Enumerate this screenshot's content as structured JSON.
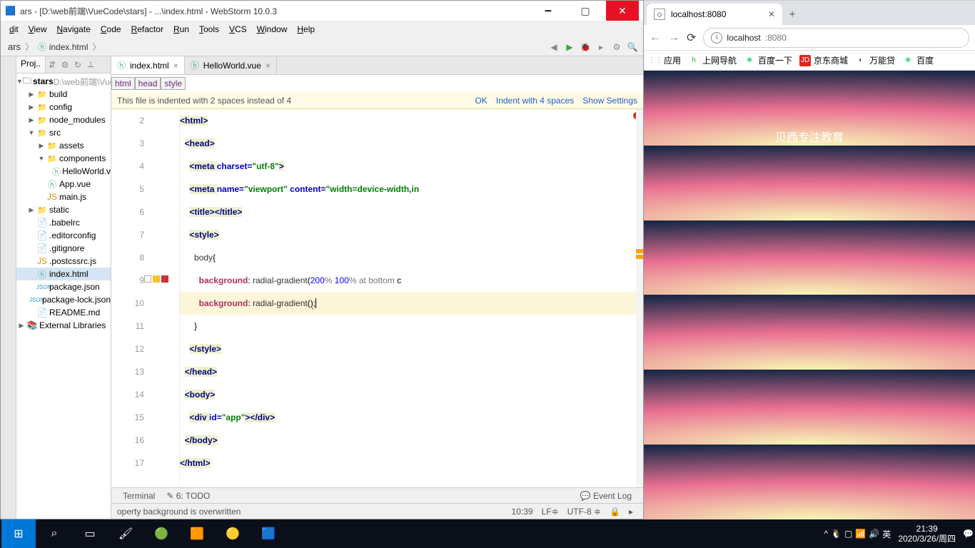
{
  "ide": {
    "title": "ars - [D:\\web前端\\VueCode\\stars] - ...\\index.html - WebStorm 10.0.3",
    "menu": [
      "dit",
      "View",
      "Navigate",
      "Code",
      "Refactor",
      "Run",
      "Tools",
      "VCS",
      "Window",
      "Help"
    ],
    "breadcrumb": {
      "root": "ars",
      "file": "index.html"
    },
    "project_tab": "Proj..",
    "project": {
      "root": {
        "name": "stars",
        "path": "D:\\web前端\\Vue"
      },
      "items": [
        {
          "t": "dir",
          "name": "build",
          "d": 1
        },
        {
          "t": "dir",
          "name": "config",
          "d": 1
        },
        {
          "t": "dir",
          "name": "node_modules",
          "d": 1
        },
        {
          "t": "dir",
          "name": "src",
          "d": 1,
          "open": true
        },
        {
          "t": "dir",
          "name": "assets",
          "d": 2
        },
        {
          "t": "dir",
          "name": "components",
          "d": 2,
          "open": true
        },
        {
          "t": "file",
          "name": "HelloWorld.v",
          "d": 3,
          "icon": "h"
        },
        {
          "t": "file",
          "name": "App.vue",
          "d": 2,
          "icon": "h"
        },
        {
          "t": "file",
          "name": "main.js",
          "d": 2,
          "icon": "js"
        },
        {
          "t": "dir",
          "name": "static",
          "d": 1
        },
        {
          "t": "file",
          "name": ".babelrc",
          "d": 1,
          "icon": "txt"
        },
        {
          "t": "file",
          "name": ".editorconfig",
          "d": 1,
          "icon": "txt"
        },
        {
          "t": "file",
          "name": ".gitignore",
          "d": 1,
          "icon": "txt"
        },
        {
          "t": "file",
          "name": ".postcssrc.js",
          "d": 1,
          "icon": "js"
        },
        {
          "t": "file",
          "name": "index.html",
          "d": 1,
          "icon": "h",
          "sel": true
        },
        {
          "t": "file",
          "name": "package.json",
          "d": 1,
          "icon": "json"
        },
        {
          "t": "file",
          "name": "package-lock.json",
          "d": 1,
          "icon": "json"
        },
        {
          "t": "file",
          "name": "README.md",
          "d": 1,
          "icon": "txt"
        }
      ],
      "ext_lib": "External Libraries"
    },
    "editor_tabs": [
      {
        "name": "index.html",
        "active": true
      },
      {
        "name": "HelloWorld.vue",
        "active": false
      }
    ],
    "path_crumbs": [
      "html",
      "head",
      "style"
    ],
    "notify": {
      "msg": "This file is indented with 2 spaces instead of 4",
      "ok": "OK",
      "indent": "Indent with 4 spaces",
      "show": "Show Settings"
    },
    "line_numbers": [
      "2",
      "3",
      "4",
      "5",
      "6",
      "7",
      "8",
      "9",
      "10",
      "11",
      "12",
      "13",
      "14",
      "15",
      "16",
      "17"
    ],
    "current_line_index": 8,
    "status_tabs": {
      "terminal": "Terminal",
      "todo": "6: TODO",
      "eventlog": "Event Log"
    },
    "status_msg": "operty background is overwritten",
    "status_right": {
      "pos": "10:39",
      "le": "LF≑",
      "enc": "UTF-8 ≑",
      "lock": "🔒",
      "more": "▸"
    }
  },
  "browser": {
    "tab_title": "localhost:8080",
    "url_host": "localhost",
    "url_port": ":8080",
    "bookmarks": [
      {
        "label": "应用",
        "icon": "⋮⋮",
        "bg": "#fff",
        "fg": "#4285f4"
      },
      {
        "label": "上网导航",
        "icon": "h",
        "bg": "#fff",
        "fg": "#3a3"
      },
      {
        "label": "百度一下",
        "icon": "❀",
        "bg": "#fff",
        "fg": "#2c7"
      },
      {
        "label": "京东商城",
        "icon": "JD",
        "bg": "#e1251b",
        "fg": "#fff"
      },
      {
        "label": "万能贷",
        "icon": "◐",
        "bg": "#fff",
        "fg": "#555"
      },
      {
        "label": "百度",
        "icon": "❀",
        "bg": "#fff",
        "fg": "#2c7"
      }
    ],
    "banner": "贝西专注教育"
  },
  "taskbar": {
    "tray": {
      "ime": "英",
      "time": "21:39",
      "date": "2020/3/26/周四"
    }
  }
}
